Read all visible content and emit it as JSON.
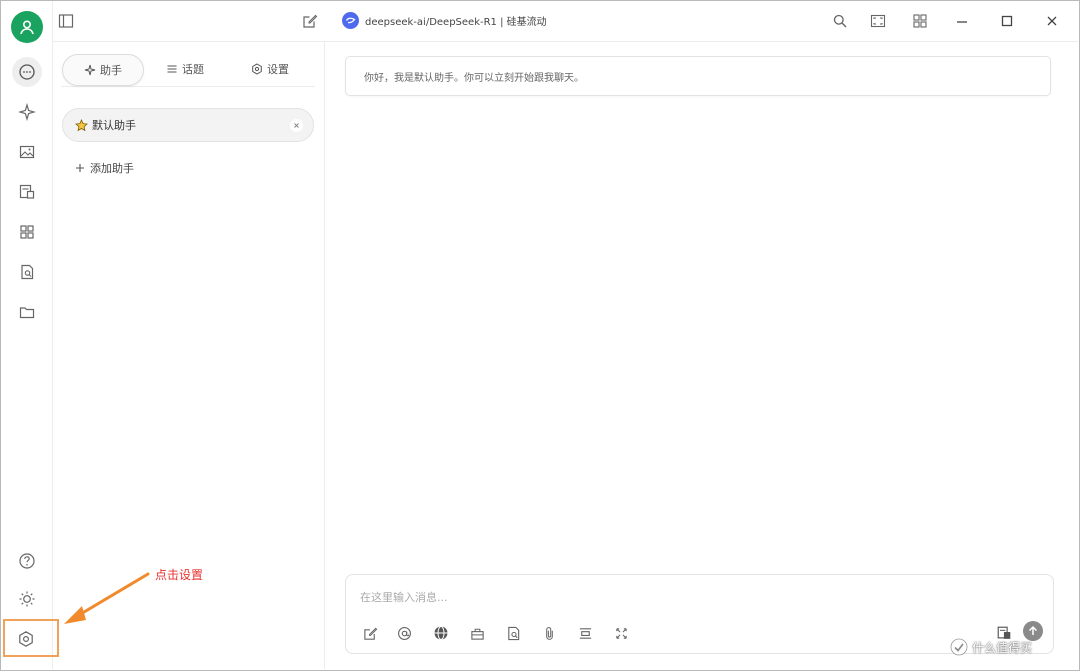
{
  "window": {
    "model_name": "deepseek-ai/DeepSeek-R1 | 硅基流动"
  },
  "sidebar": {
    "icons": [
      "chat-icon",
      "sparkle-icon",
      "image-icon",
      "translate-icon",
      "apps-icon",
      "knowledge-icon",
      "folder-icon"
    ],
    "bottom_icons": [
      "help-icon",
      "theme-icon",
      "settings-icon"
    ]
  },
  "panel": {
    "tabs": [
      {
        "label": "助手",
        "icon": "assistant-icon"
      },
      {
        "label": "话题",
        "icon": "list-icon"
      },
      {
        "label": "设置",
        "icon": "gear-icon"
      }
    ],
    "assistant": {
      "label": "默认助手",
      "icon": "star-icon"
    },
    "add_label": "添加助手"
  },
  "chat": {
    "welcome": "你好，我是默认助手。你可以立刻开始跟我聊天。",
    "input_placeholder": "在这里输入消息..."
  },
  "annotation": {
    "text": "点击设置",
    "color": "#e8312f",
    "arrow_color": "#f08a2c"
  },
  "watermark": {
    "text": "什么值得买"
  },
  "colors": {
    "accent_green": "#1aa260",
    "model_blue": "#4f6bed",
    "highlight_orange": "#f0a15a"
  }
}
